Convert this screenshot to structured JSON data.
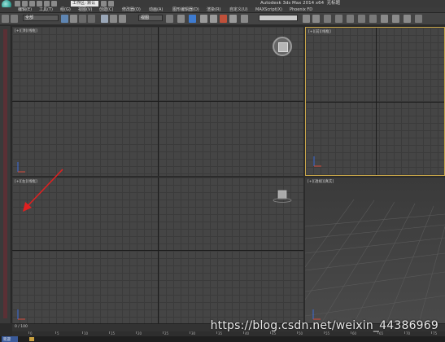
{
  "app": {
    "workspace_label": "工作区: 默认",
    "window_title": "Autodesk 3ds Max 2014 x64",
    "window_title_suffix": "无标题"
  },
  "menu": [
    "编辑(E)",
    "工具(T)",
    "组(G)",
    "视图(V)",
    "创建(C)",
    "修改器(O)",
    "动画(A)",
    "图形编辑器(D)",
    "渲染(R)",
    "自定义(U)",
    "MAXScript(X)",
    "Phoenix FD"
  ],
  "toolbar": {
    "selection_filter": "全部",
    "reference_coord": "视图"
  },
  "viewports": {
    "top_label": "[+][顶][线框]",
    "front_label": "[+][前][线框]",
    "left_label": "[+][左][线框]",
    "persp_label": "[+][透视][真实]"
  },
  "timeline": {
    "frame_display": "0 / 100"
  },
  "trackbar": {
    "ticks": [
      "0",
      "5",
      "10",
      "15",
      "20",
      "25",
      "30",
      "35",
      "40",
      "45",
      "50",
      "55",
      "60",
      "65",
      "70",
      "75"
    ]
  },
  "status": {
    "left_label": "欢迎"
  },
  "watermark": "https://blog.csdn.net/weixin_44386969",
  "colors": {
    "active_viewport_border": "#c8a64a",
    "annotation_arrow": "#e02020"
  }
}
